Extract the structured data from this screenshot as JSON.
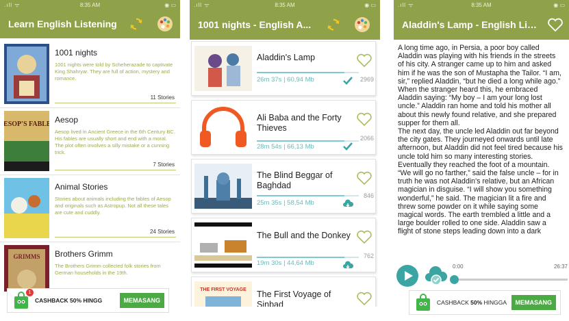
{
  "status_bar": {
    "time": "8:35 AM"
  },
  "screen1": {
    "title": "Learn English Listening",
    "collections": [
      {
        "name": "1001 nights",
        "description": "1001 nights were told by Scheherazade to captivate King Shahryar. They are full of action, mystery and romance.",
        "count": "11 Stories"
      },
      {
        "name": "Aesop",
        "description": "Aesop lived in Ancient Greece in the 6th Century BC. His fables are usually short and end with a moral. The plot often involves a silly mistake or a cunning trick.",
        "count": "7 Stories",
        "cover_text": "AESOP'S FABLES"
      },
      {
        "name": "Animal Stories",
        "description": "Stories about animals including the fables of Aesop and originals such as Astropup. Not all these tales are cute and cuddly.",
        "count": "24 Stories"
      },
      {
        "name": "Brothers Grimm",
        "description": "The Brothers Grimm collected folk stories from German households in the 19th.",
        "count": "",
        "cover_text": "GRIMMS"
      }
    ],
    "banner": {
      "text": "CASHBACK 50% HINGG",
      "button": "MEMASANG",
      "badge": "1"
    }
  },
  "screen2": {
    "title": "1001 nights - English A...",
    "stories": [
      {
        "name": "Aladdin's Lamp",
        "meta": "26m 37s | 60,94 Mb",
        "count": "2969",
        "status": "downloaded",
        "progress": 0.86
      },
      {
        "name": "Ali Baba and the Forty Thieves",
        "meta": "28m 54s | 66,13 Mb",
        "count": "2066",
        "status": "downloaded",
        "progress": 0.86
      },
      {
        "name": "The Blind Beggar of Baghdad",
        "meta": "25m 35s | 58,54 Mb",
        "count": "846",
        "status": "cloud",
        "progress": 0.86
      },
      {
        "name": "The Bull and the Donkey",
        "meta": "19m 30s | 44,64 Mb",
        "count": "762",
        "status": "cloud",
        "progress": 0.86
      },
      {
        "name": "The First Voyage of Sinbad",
        "meta": "",
        "count": "",
        "status": "",
        "progress": 0
      }
    ],
    "cover_text": "THE FIRST VOYAGE"
  },
  "screen3": {
    "title": "Aladdin's Lamp - English List...",
    "story_paragraphs": [
      "A long time ago, in Persia, a poor boy called Aladdin was playing with his friends in the streets of his city. A stranger came up to him and asked him if he was the son of Mustapha the Tailor. “I am, sir,” replied Aladdin, “but he died a long while ago.” When the stranger heard this, he embraced Aladdin saying: “My boy – I am your long lost uncle.” Aladdin ran home and told his mother all about this newly found relative, and she prepared supper for them all.",
      "The next day, the uncle led Aladdin out far beyond the city gates. They journeyed onwards until late afternoon, but Aladdin did not feel tired because his uncle told him so many interesting stories. Eventually they reached the foot of a mountain.",
      "“We will go no farther,” said the false uncle – for in truth he was not Aladdin's relative, but an African magician in disguise. “I will show you something wonderful,” he said. The magician lit a fire and threw some powder on it while saying some magical words. The earth trembled a little and a large boulder rolled to one side. Aladdin saw a flight of stone steps leading down into a dark"
    ],
    "player": {
      "elapsed": "0:00",
      "total": "26:37",
      "progress": 0.0
    },
    "banner": {
      "text_a": "CASHBACK ",
      "text_b": "50%",
      "text_c": " HINGGA",
      "button": "MEMASANG"
    }
  },
  "colors": {
    "accent": "#8fa24a",
    "teal": "#3ba5a3",
    "green_button": "#4caa45"
  }
}
